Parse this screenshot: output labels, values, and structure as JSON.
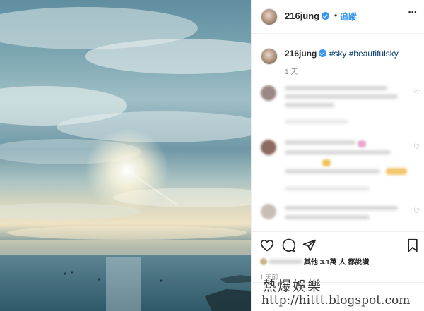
{
  "post": {
    "username": "216jung",
    "follow_label": "追蹤",
    "separator": "•",
    "more_label": "•••"
  },
  "caption": {
    "username": "216jung",
    "hashtags": "#sky #beautifulsky",
    "time": "1 天"
  },
  "likes": {
    "text": "其他 3.1萬 人 都說讚"
  },
  "post_time": "1 天前",
  "watermark": {
    "line1": "熱爆娛樂",
    "line2": "http://hittt.blogspot.com"
  },
  "icons": {
    "verified": "verified-badge-icon",
    "heart": "heart-icon",
    "comment": "comment-icon",
    "share": "share-icon",
    "bookmark": "bookmark-icon"
  },
  "colors": {
    "accent": "#3897f0",
    "hashtag": "#00376b",
    "muted": "#8e8e8e"
  }
}
